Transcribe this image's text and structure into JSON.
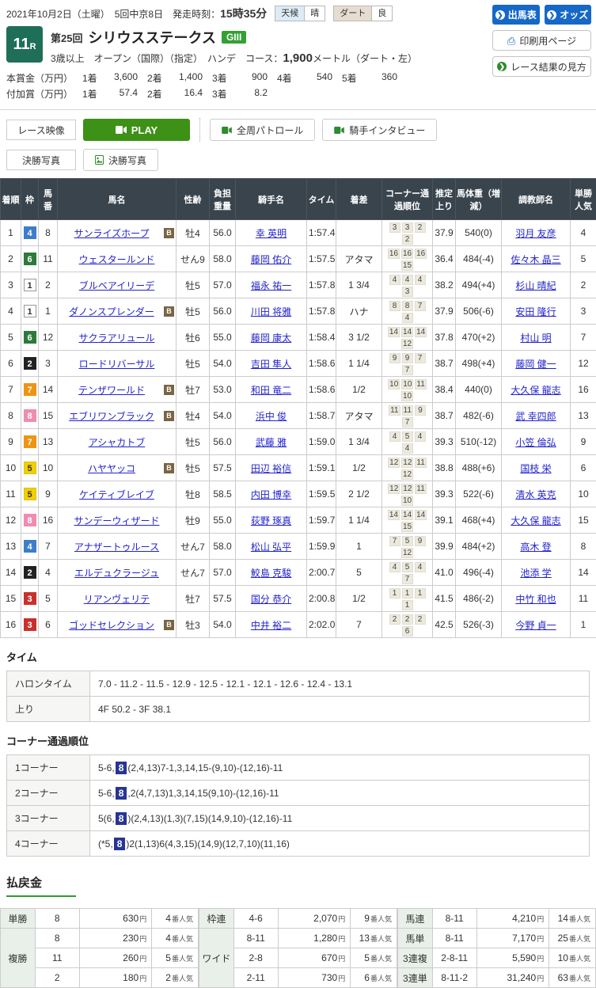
{
  "colors": {
    "accent_blue": "#1668c7",
    "play_green": "#3d9116",
    "table_header": "#39444d",
    "grade_green": "#33a033",
    "race_box_green": "#1f6e58",
    "corner_highlight": "#283593",
    "payout_underline": "#2e9b2e"
  },
  "header": {
    "date": "2021年10月2日（土曜）",
    "meet": "5回中京8日",
    "start_label": "発走時刻：",
    "start_time": "15時35分",
    "weather": {
      "label": "天候",
      "value": "晴"
    },
    "track": {
      "label": "ダート",
      "value": "良"
    },
    "btn_entry": "出馬表",
    "btn_odds": "オッズ",
    "btn_print": "印刷用ページ",
    "btn_guide": "レース結果の見方"
  },
  "race": {
    "number": "11",
    "number_suffix": "R",
    "edition": "第25回",
    "title": "シリウスステークス",
    "grade": "GIII",
    "conditions": "3歳以上　オープン（国際）（指定）　ハンデ",
    "course_label": "コース：",
    "course_value": "1,900",
    "course_unit": "メートル（ダート・左）"
  },
  "prizes": {
    "main_label": "本賞金（万円）",
    "main": [
      {
        "rank": "1着",
        "value": "3,600"
      },
      {
        "rank": "2着",
        "value": "1,400"
      },
      {
        "rank": "3着",
        "value": "900"
      },
      {
        "rank": "4着",
        "value": "540"
      },
      {
        "rank": "5着",
        "value": "360"
      }
    ],
    "added_label": "付加賞（万円）",
    "added": [
      {
        "rank": "1着",
        "value": "57.4"
      },
      {
        "rank": "2着",
        "value": "16.4"
      },
      {
        "rank": "3着",
        "value": "8.2"
      }
    ]
  },
  "media": {
    "video_label": "レース映像",
    "play_label": "PLAY",
    "patrol_label": "全周パトロール",
    "interview_label": "騎手インタビュー",
    "photo_label": "決勝写真",
    "photo_button": "決勝写真"
  },
  "results": {
    "b_badge": "B",
    "headers": [
      "着順",
      "枠",
      "馬番",
      "馬名",
      "性齢",
      "負担重量",
      "騎手名",
      "タイム",
      "着差",
      "コーナー通過順位",
      "推定上り",
      "馬体重（増減）",
      "調教師名",
      "単勝人気"
    ],
    "waku_colors": {
      "1": {
        "bg": "#ffffff",
        "fg": "#333333",
        "border": "#999999"
      },
      "2": {
        "bg": "#222222",
        "fg": "#ffffff",
        "border": "#222222"
      },
      "3": {
        "bg": "#c9302c",
        "fg": "#ffffff",
        "border": "#c9302c"
      },
      "4": {
        "bg": "#3d7dca",
        "fg": "#ffffff",
        "border": "#3d7dca"
      },
      "5": {
        "bg": "#f2d000",
        "fg": "#333333",
        "border": "#e0c000"
      },
      "6": {
        "bg": "#2d7a3a",
        "fg": "#ffffff",
        "border": "#2d7a3a"
      },
      "7": {
        "bg": "#ef9413",
        "fg": "#ffffff",
        "border": "#ef9413"
      },
      "8": {
        "bg": "#f08cb1",
        "fg": "#ffffff",
        "border": "#f08cb1"
      }
    },
    "rows": [
      {
        "pos": "1",
        "waku": "4",
        "num": "8",
        "name": "サンライズホープ",
        "blinker": true,
        "sexage": "牡4",
        "weight": "56.0",
        "jockey": "幸 英明",
        "time": "1:57.4",
        "margin": "",
        "corners": [
          "3",
          "3",
          "2",
          "2"
        ],
        "agari": "37.9",
        "hweight": "540(0)",
        "trainer": "羽月 友彦",
        "pop": "4"
      },
      {
        "pos": "2",
        "waku": "6",
        "num": "11",
        "name": "ウェスタールンド",
        "blinker": false,
        "sexage": "せん9",
        "weight": "58.0",
        "jockey": "藤岡 佑介",
        "time": "1:57.5",
        "margin": "アタマ",
        "corners": [
          "16",
          "16",
          "16",
          "15"
        ],
        "agari": "36.4",
        "hweight": "484(-4)",
        "trainer": "佐々木 晶三",
        "pop": "5"
      },
      {
        "pos": "3",
        "waku": "1",
        "num": "2",
        "name": "ブルベアイリーデ",
        "blinker": false,
        "sexage": "牡5",
        "weight": "57.0",
        "jockey": "福永 祐一",
        "time": "1:57.8",
        "margin": "1 3/4",
        "corners": [
          "4",
          "4",
          "4",
          "3"
        ],
        "agari": "38.2",
        "hweight": "494(+4)",
        "trainer": "杉山 晴紀",
        "pop": "2"
      },
      {
        "pos": "4",
        "waku": "1",
        "num": "1",
        "name": "ダノンスプレンダー",
        "blinker": true,
        "sexage": "牡5",
        "weight": "56.0",
        "jockey": "川田 将雅",
        "time": "1:57.8",
        "margin": "ハナ",
        "corners": [
          "8",
          "8",
          "7",
          "4"
        ],
        "agari": "37.9",
        "hweight": "506(-6)",
        "trainer": "安田 隆行",
        "pop": "3"
      },
      {
        "pos": "5",
        "waku": "6",
        "num": "12",
        "name": "サクラアリュール",
        "blinker": false,
        "sexage": "牡6",
        "weight": "55.0",
        "jockey": "藤岡 康太",
        "time": "1:58.4",
        "margin": "3 1/2",
        "corners": [
          "14",
          "14",
          "14",
          "12"
        ],
        "agari": "37.8",
        "hweight": "470(+2)",
        "trainer": "村山 明",
        "pop": "7"
      },
      {
        "pos": "6",
        "waku": "2",
        "num": "3",
        "name": "ロードリバーサル",
        "blinker": false,
        "sexage": "牡5",
        "weight": "54.0",
        "jockey": "吉田 隼人",
        "time": "1:58.6",
        "margin": "1 1/4",
        "corners": [
          "9",
          "9",
          "7",
          "7"
        ],
        "agari": "38.7",
        "hweight": "498(+4)",
        "trainer": "藤岡 健一",
        "pop": "12"
      },
      {
        "pos": "7",
        "waku": "7",
        "num": "14",
        "name": "テンザワールド",
        "blinker": true,
        "sexage": "牡7",
        "weight": "53.0",
        "jockey": "和田 竜二",
        "time": "1:58.6",
        "margin": "1/2",
        "corners": [
          "10",
          "10",
          "11",
          "10"
        ],
        "agari": "38.4",
        "hweight": "440(0)",
        "trainer": "大久保 龍志",
        "pop": "16"
      },
      {
        "pos": "8",
        "waku": "8",
        "num": "15",
        "name": "エブリワンブラック",
        "blinker": true,
        "sexage": "牡4",
        "weight": "54.0",
        "jockey": "浜中 俊",
        "time": "1:58.7",
        "margin": "アタマ",
        "corners": [
          "11",
          "11",
          "9",
          "7"
        ],
        "agari": "38.7",
        "hweight": "482(-6)",
        "trainer": "武 幸四郎",
        "pop": "13"
      },
      {
        "pos": "9",
        "waku": "7",
        "num": "13",
        "name": "アシャカトブ",
        "blinker": false,
        "sexage": "牡5",
        "weight": "56.0",
        "jockey": "武藤 雅",
        "time": "1:59.0",
        "margin": "1 3/4",
        "corners": [
          "4",
          "5",
          "4",
          "4"
        ],
        "agari": "39.3",
        "hweight": "510(-12)",
        "trainer": "小笠 倫弘",
        "pop": "9"
      },
      {
        "pos": "10",
        "waku": "5",
        "num": "10",
        "name": "ハヤヤッコ",
        "blinker": true,
        "sexage": "牡5",
        "weight": "57.5",
        "jockey": "田辺 裕信",
        "time": "1:59.1",
        "margin": "1/2",
        "corners": [
          "12",
          "12",
          "11",
          "12"
        ],
        "agari": "38.8",
        "hweight": "488(+6)",
        "trainer": "国枝 栄",
        "pop": "6"
      },
      {
        "pos": "11",
        "waku": "5",
        "num": "9",
        "name": "ケイティブレイブ",
        "blinker": false,
        "sexage": "牡8",
        "weight": "58.5",
        "jockey": "内田 博幸",
        "time": "1:59.5",
        "margin": "2 1/2",
        "corners": [
          "12",
          "12",
          "11",
          "10"
        ],
        "agari": "39.3",
        "hweight": "522(-6)",
        "trainer": "清水 英克",
        "pop": "10"
      },
      {
        "pos": "12",
        "waku": "8",
        "num": "16",
        "name": "サンデーウィザード",
        "blinker": false,
        "sexage": "牡9",
        "weight": "55.0",
        "jockey": "荻野 琢真",
        "time": "1:59.7",
        "margin": "1 1/4",
        "corners": [
          "14",
          "14",
          "14",
          "15"
        ],
        "agari": "39.1",
        "hweight": "468(+4)",
        "trainer": "大久保 龍志",
        "pop": "15"
      },
      {
        "pos": "13",
        "waku": "4",
        "num": "7",
        "name": "アナザートゥルース",
        "blinker": false,
        "sexage": "せん7",
        "weight": "58.0",
        "jockey": "松山 弘平",
        "time": "1:59.9",
        "margin": "1",
        "corners": [
          "7",
          "5",
          "9",
          "12"
        ],
        "agari": "39.9",
        "hweight": "484(+2)",
        "trainer": "高木 登",
        "pop": "8"
      },
      {
        "pos": "14",
        "waku": "2",
        "num": "4",
        "name": "エルデュクラージュ",
        "blinker": false,
        "sexage": "せん7",
        "weight": "57.0",
        "jockey": "鮫島 克駿",
        "time": "2:00.7",
        "margin": "5",
        "corners": [
          "4",
          "5",
          "4",
          "7"
        ],
        "agari": "41.0",
        "hweight": "496(-4)",
        "trainer": "池添 学",
        "pop": "14"
      },
      {
        "pos": "15",
        "waku": "3",
        "num": "5",
        "name": "リアンヴェリテ",
        "blinker": false,
        "sexage": "牡7",
        "weight": "57.5",
        "jockey": "国分 恭介",
        "time": "2:00.8",
        "margin": "1/2",
        "corners": [
          "1",
          "1",
          "1",
          "1"
        ],
        "agari": "41.5",
        "hweight": "486(-2)",
        "trainer": "中竹 和也",
        "pop": "11"
      },
      {
        "pos": "16",
        "waku": "3",
        "num": "6",
        "name": "ゴッドセレクション",
        "blinker": true,
        "sexage": "牡3",
        "weight": "54.0",
        "jockey": "中井 裕二",
        "time": "2:02.0",
        "margin": "7",
        "corners": [
          "2",
          "2",
          "2",
          "6"
        ],
        "agari": "42.5",
        "hweight": "526(-3)",
        "trainer": "今野 貞一",
        "pop": "1"
      }
    ]
  },
  "time_section": {
    "title": "タイム",
    "furlong_label": "ハロンタイム",
    "furlong_value": "7.0 - 11.2 - 11.5 - 12.9 - 12.5 - 12.1 - 12.1 - 12.6 - 12.4 - 13.1",
    "agari_label": "上り",
    "agari_value": "4F 50.2 - 3F 38.1"
  },
  "corner_section": {
    "title": "コーナー通過順位",
    "highlight": "8",
    "rows": [
      {
        "label": "1コーナー",
        "before": "5-6,",
        "after": "(2,4,13)7-1,3,14,15-(9,10)-(12,16)-11"
      },
      {
        "label": "2コーナー",
        "before": "5-6,",
        "after": ",2(4,7,13)1,3,14,15(9,10)-(12,16)-11"
      },
      {
        "label": "3コーナー",
        "before": "5(6,",
        "after": ")(2,4,13)(1,3)(7,15)(14,9,10)-(12,16)-11"
      },
      {
        "label": "4コーナー",
        "before": "(*5,",
        "after": ")2(1,13)6(4,3,15)(14,9)(12,7,10)(11,16)"
      }
    ]
  },
  "payout": {
    "title": "払戻金",
    "yen_unit": "円",
    "pop_unit": "番人気",
    "groups": [
      [
        {
          "label": "単勝",
          "rows": [
            {
              "comb": "8",
              "amount": "630",
              "pop": "4"
            }
          ]
        },
        {
          "label": "複勝",
          "rows": [
            {
              "comb": "8",
              "amount": "230",
              "pop": "4"
            },
            {
              "comb": "11",
              "amount": "260",
              "pop": "5"
            },
            {
              "comb": "2",
              "amount": "180",
              "pop": "2"
            }
          ]
        }
      ],
      [
        {
          "label": "枠連",
          "rows": [
            {
              "comb": "4-6",
              "amount": "2,070",
              "pop": "9"
            }
          ]
        },
        {
          "label": "ワイド",
          "rows": [
            {
              "comb": "8-11",
              "amount": "1,280",
              "pop": "13"
            },
            {
              "comb": "2-8",
              "amount": "670",
              "pop": "5"
            },
            {
              "comb": "2-11",
              "amount": "730",
              "pop": "6"
            }
          ]
        }
      ],
      [
        {
          "label": "馬連",
          "rows": [
            {
              "comb": "8-11",
              "amount": "4,210",
              "pop": "14"
            }
          ]
        },
        {
          "label": "馬単",
          "rows": [
            {
              "comb": "8-11",
              "amount": "7,170",
              "pop": "25"
            }
          ]
        },
        {
          "label": "3連複",
          "rows": [
            {
              "comb": "2-8-11",
              "amount": "5,590",
              "pop": "10"
            }
          ]
        },
        {
          "label": "3連単",
          "rows": [
            {
              "comb": "8-11-2",
              "amount": "31,240",
              "pop": "63"
            }
          ]
        }
      ]
    ]
  }
}
